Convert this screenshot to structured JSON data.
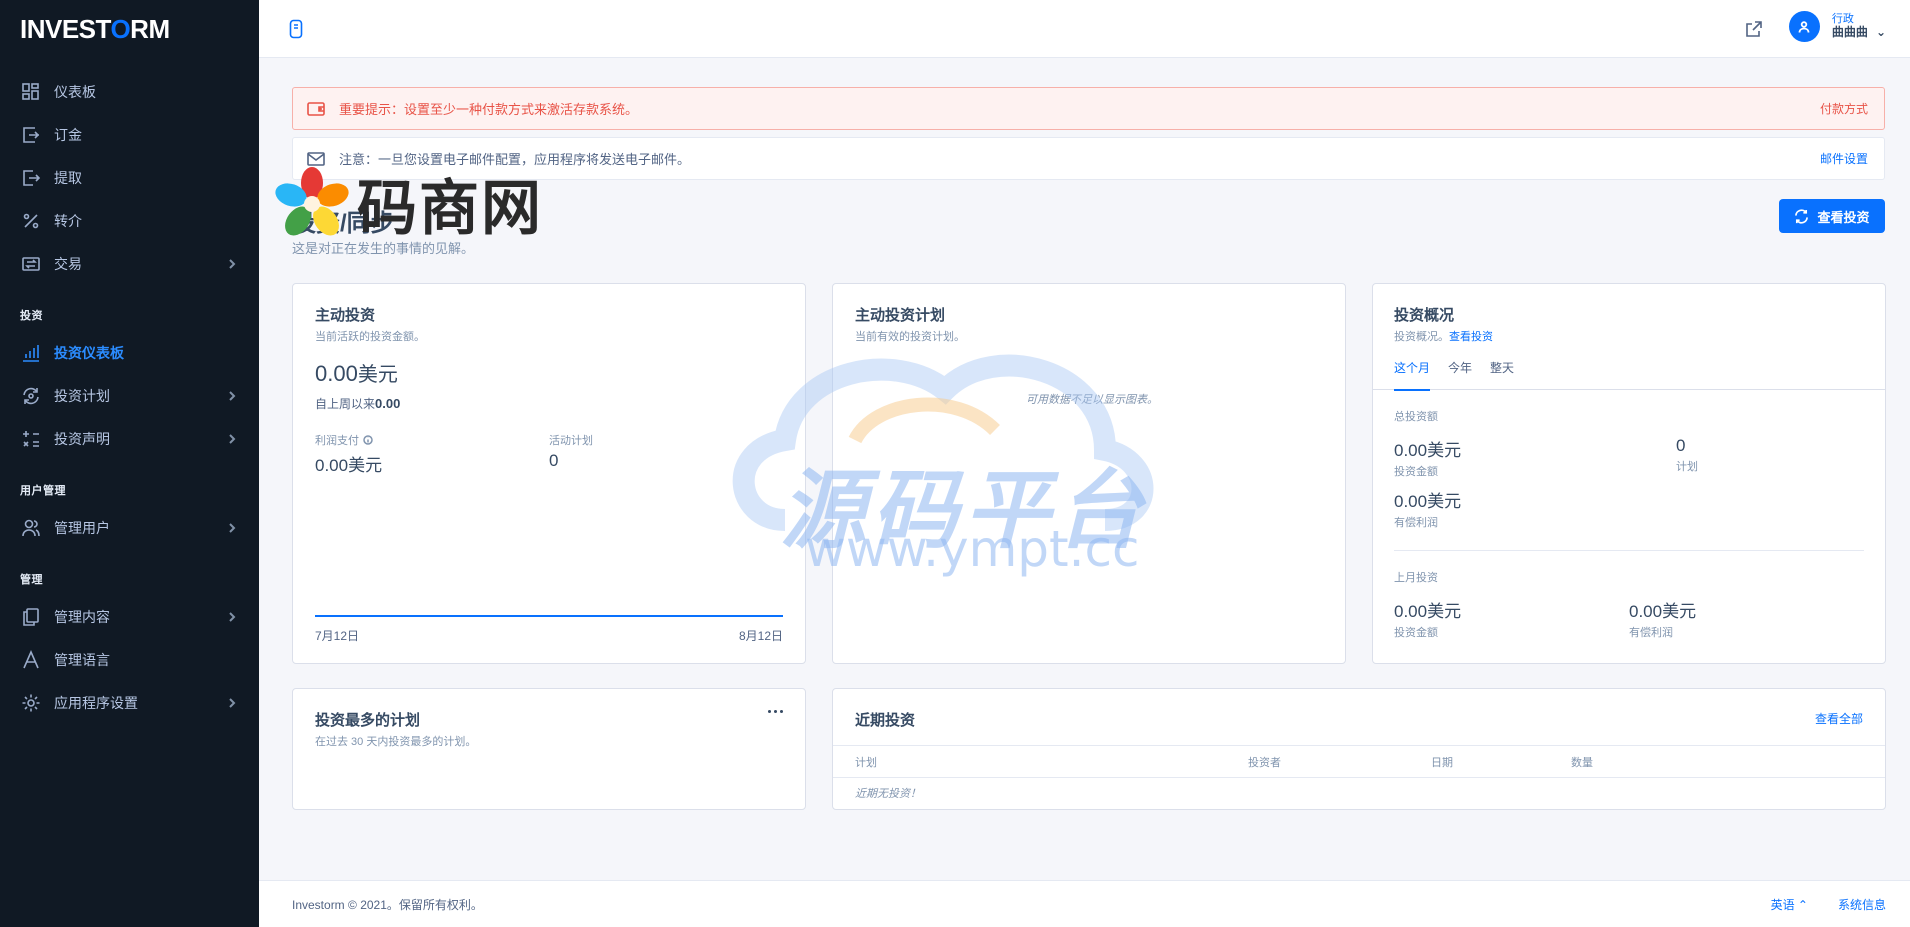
{
  "app": {
    "logo_prefix": "INVEST",
    "logo_o": "O",
    "logo_suffix": "RM"
  },
  "sidebar": {
    "items": [
      {
        "label": "仪表板"
      },
      {
        "label": "订金"
      },
      {
        "label": "提取"
      },
      {
        "label": "转介"
      },
      {
        "label": "交易"
      }
    ],
    "invest_heading": "投资",
    "invest_items": [
      {
        "label": "投资仪表板"
      },
      {
        "label": "投资计划"
      },
      {
        "label": "投资声明"
      }
    ],
    "users_heading": "用户管理",
    "users_items": [
      {
        "label": "管理用户"
      }
    ],
    "manage_heading": "管理",
    "manage_items": [
      {
        "label": "管理内容"
      },
      {
        "label": "管理语言"
      },
      {
        "label": "应用程序设置"
      }
    ]
  },
  "header": {
    "user_role": "行政",
    "user_name": "曲曲曲"
  },
  "alerts": {
    "payment": {
      "text": "重要提示：设置至少一种付款方式来激活存款系统。",
      "link": "付款方式"
    },
    "email": {
      "text": "注意：一旦您设置电子邮件配置，应用程序将发送电子邮件。",
      "link": "邮件设置"
    }
  },
  "page": {
    "title": "投资/同步",
    "subtitle": "这是对正在发生的事情的见解。",
    "button": "查看投资"
  },
  "active_investment": {
    "title": "主动投资",
    "subtitle": "当前活跃的投资金额。",
    "amount": "0.00",
    "currency": "美元",
    "since_label": "自上周以来",
    "since_value": "0.00",
    "profit_label": "利润支付",
    "profit_value": "0.00美元",
    "active_plans_label": "活动计划",
    "active_plans_value": "0",
    "x_start": "7月12日",
    "x_end": "8月12日"
  },
  "active_plans": {
    "title": "主动投资计划",
    "subtitle": "当前有效的投资计划。",
    "empty": "可用数据不足以显示图表。"
  },
  "overview": {
    "title": "投资概况",
    "subtitle": "投资概况。",
    "link": "查看投资",
    "tabs": [
      "这个月",
      "今年",
      "整天"
    ],
    "total_label": "总投资额",
    "invest_amount": "0.00美元",
    "invest_amount_label": "投资金额",
    "plans_value": "0",
    "plans_label": "计划",
    "paid_profit": "0.00美元",
    "paid_profit_label": "有偿利润",
    "last_month_label": "上月投资",
    "lm_invest_amount": "0.00美元",
    "lm_invest_label": "投资金额",
    "lm_profit": "0.00美元",
    "lm_profit_label": "有偿利润"
  },
  "top_plans": {
    "title": "投资最多的计划",
    "subtitle": "在过去 30 天内投资最多的计划。"
  },
  "recent": {
    "title": "近期投资",
    "link": "查看全部",
    "columns": [
      "计划",
      "投资者",
      "日期",
      "数量"
    ],
    "empty": "近期无投资！"
  },
  "footer": {
    "copyright": "Investorm © 2021。保留所有权利。",
    "language": "英语 ⌃",
    "sysinfo": "系统信息"
  },
  "watermarks": {
    "logo_text": "码商网",
    "title": "源码平台",
    "url": "www.ympt.cc"
  },
  "colors": {
    "primary": "#0971fe",
    "sidebar_bg": "#101924",
    "danger": "#e85347"
  }
}
